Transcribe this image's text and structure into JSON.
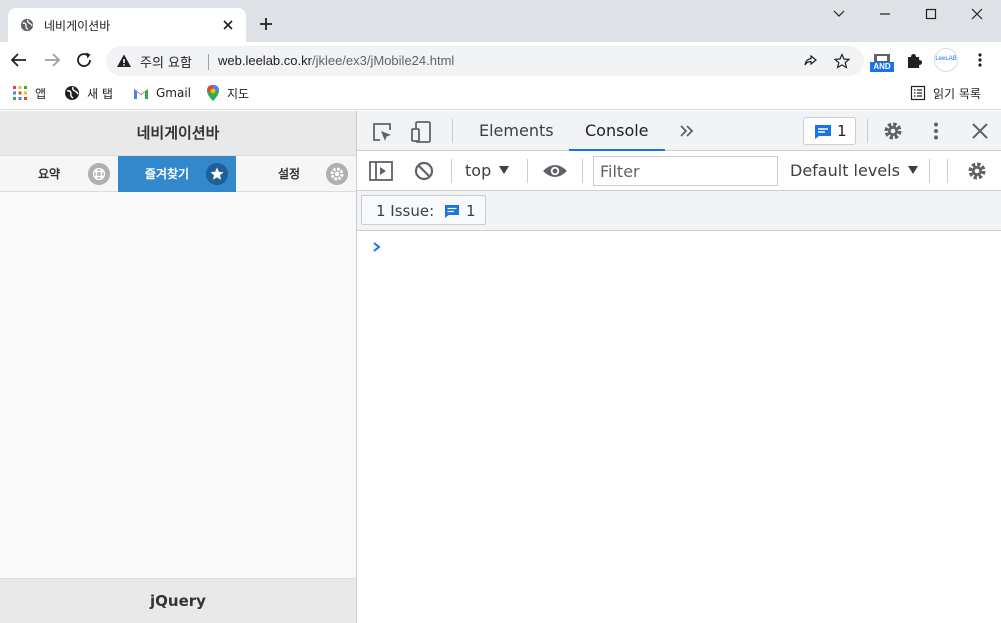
{
  "browser": {
    "tab_title": "네비게이션바",
    "security_warning": "주의 요함",
    "url_host": "web.leelab.co.kr",
    "url_path": "/jklee/ex3/jMobile24.html",
    "ext_and_label": "AND",
    "ext_leelab_label": "LeeLAB",
    "bookmarks": {
      "apps": "앱",
      "new_tab": "새 탭",
      "gmail": "Gmail",
      "maps": "지도",
      "reading_list": "읽기 목록"
    }
  },
  "page": {
    "header_title": "네비게이션바",
    "navbar": [
      {
        "label": "요약",
        "icon": "grid-icon"
      },
      {
        "label": "즐겨찾기",
        "icon": "star-icon",
        "active": true
      },
      {
        "label": "설정",
        "icon": "gear-icon"
      }
    ],
    "footer_title": "jQuery"
  },
  "devtools": {
    "tabs": {
      "elements": "Elements",
      "console": "Console"
    },
    "issue_count": "1",
    "context": "top",
    "filter_placeholder": "Filter",
    "levels": "Default levels",
    "issues_label": "1 Issue:",
    "issues_count": "1"
  },
  "colors": {
    "nav_active": "#3388cc",
    "accent": "#1a73e8"
  }
}
